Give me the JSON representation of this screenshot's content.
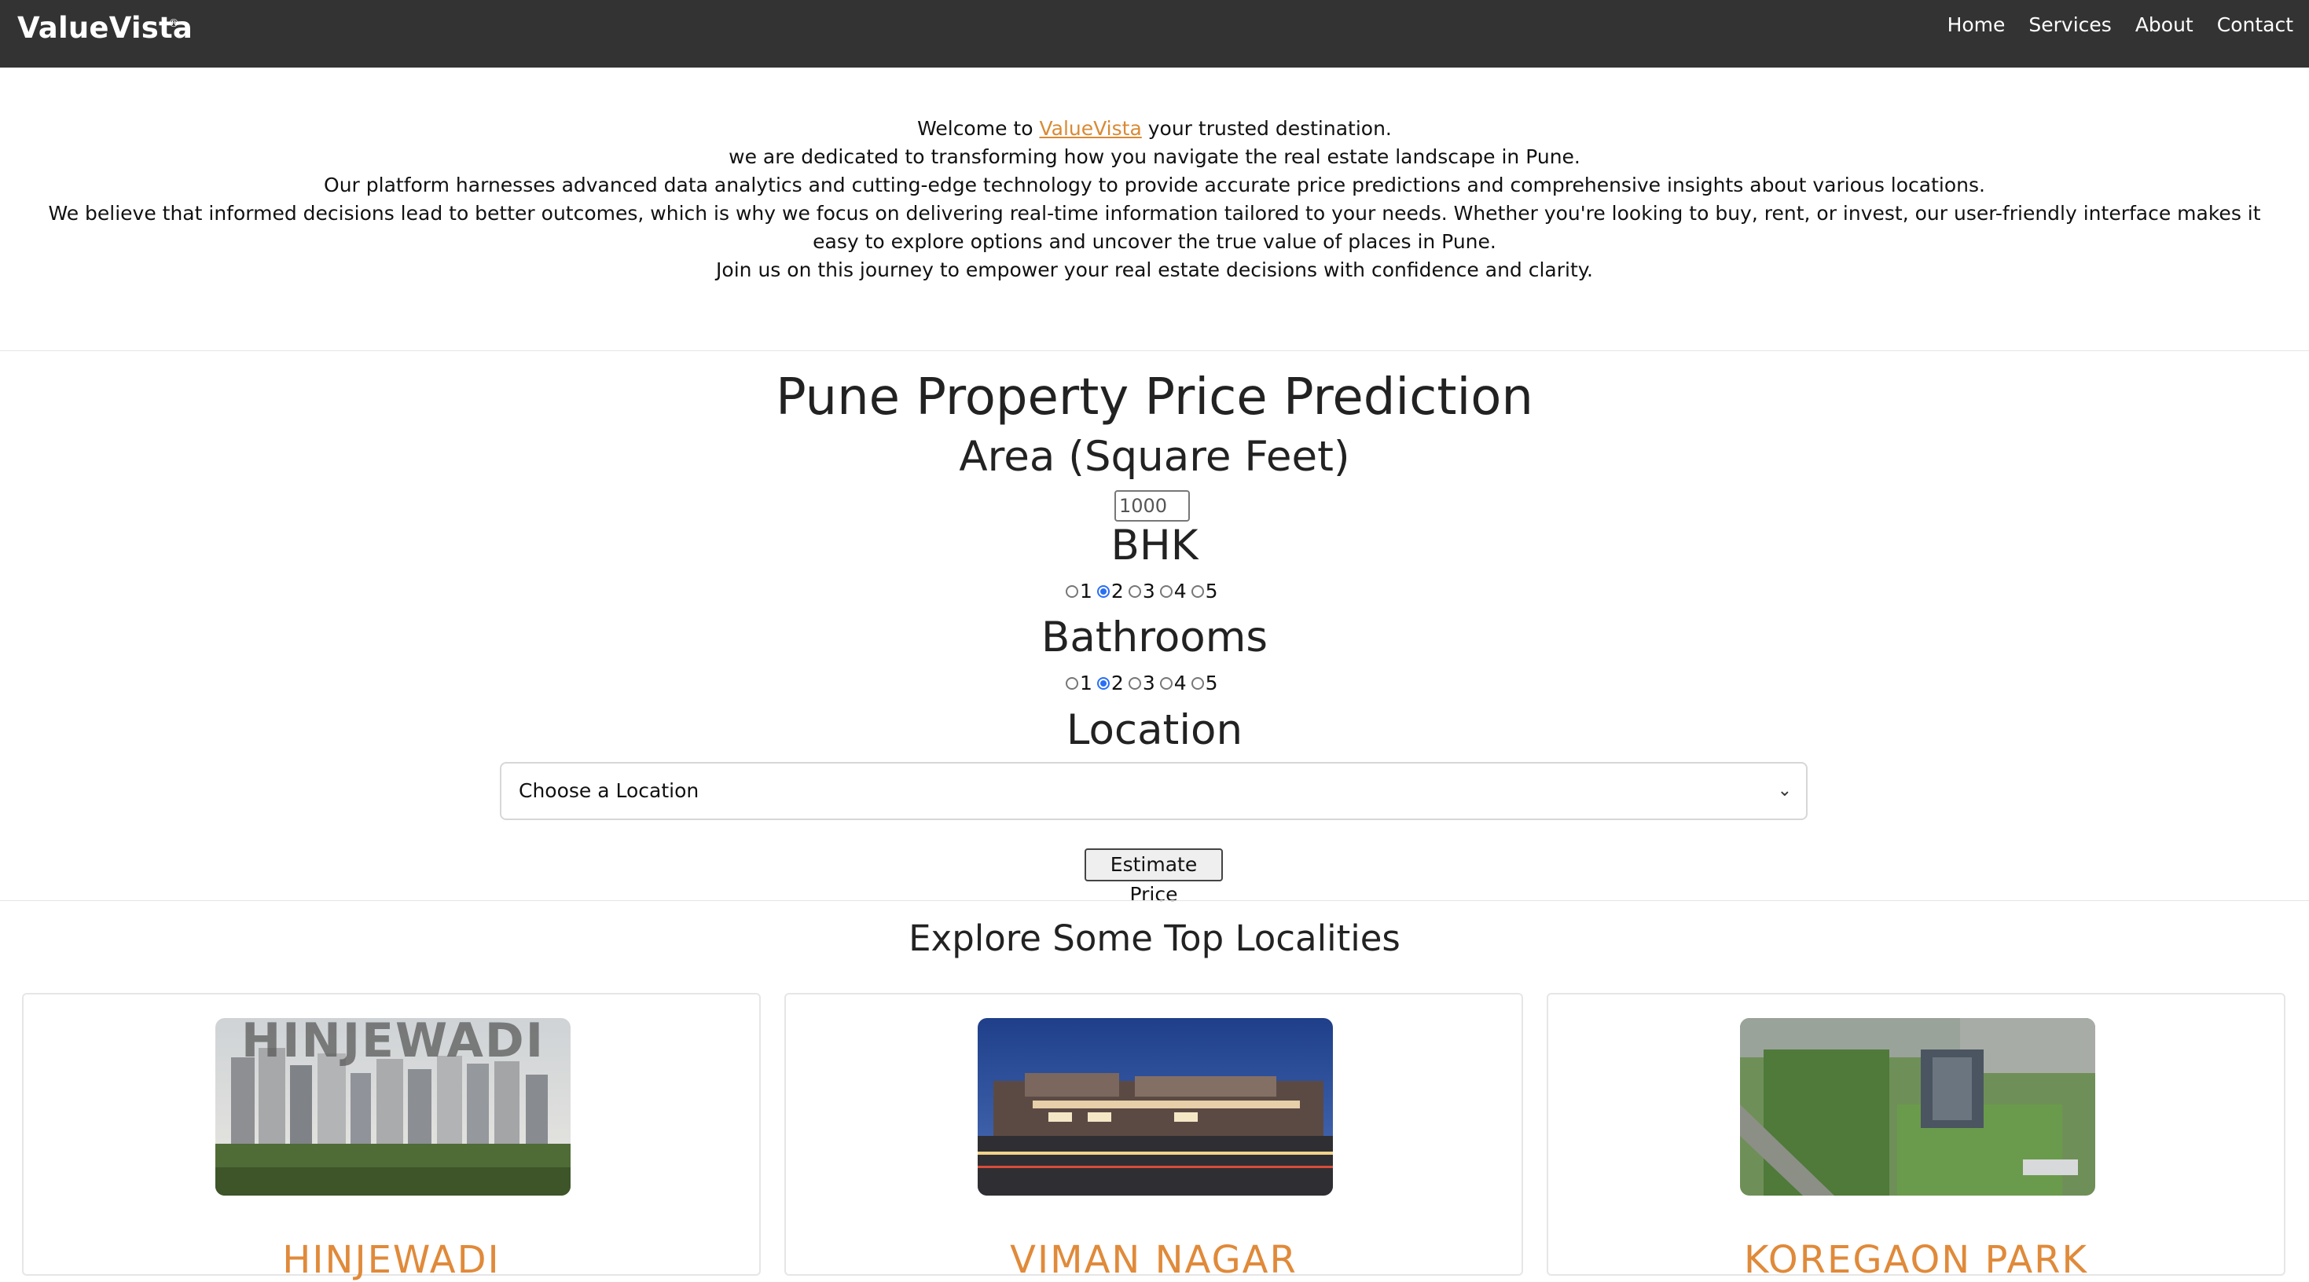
{
  "navbar": {
    "brand": "ValueVista",
    "brand_mark": "®",
    "links": [
      "Home",
      "Services",
      "About",
      "Contact"
    ]
  },
  "intro": {
    "line1_prefix": "Welcome to",
    "line1_link": "ValueVista",
    "line1_suffix": "your trusted destination.",
    "line2": "we are dedicated to transforming how you navigate the real estate landscape in Pune.",
    "line3": "Our platform harnesses advanced data analytics and cutting-edge technology to provide accurate price predictions and comprehensive insights about various locations.",
    "line4": "We believe that informed decisions lead to better outcomes, which is why we focus on delivering real-time information tailored to your needs. Whether you're looking to buy, rent, or invest, our user-friendly interface makes it easy to explore options and uncover the true value of places in Pune.",
    "line5": "Join us on this journey to empower your real estate decisions with confidence and clarity."
  },
  "form": {
    "title": "Pune Property Price Prediction",
    "area_label": "Area (Square Feet)",
    "area_value": "1000",
    "bhk_label": "BHK",
    "bhk_options": [
      "1",
      "2",
      "3",
      "4",
      "5"
    ],
    "bhk_selected": "2",
    "bath_label": "Bathrooms",
    "bath_options": [
      "1",
      "2",
      "3",
      "4",
      "5"
    ],
    "bath_selected": "2",
    "location_label": "Location",
    "location_select": "Choose a Location",
    "estimate_button": "Estimate Price"
  },
  "localities": {
    "title": "Explore Some Top Localities",
    "cards": [
      {
        "name": "HINJEWADI",
        "image_text": "HINJEWADI"
      },
      {
        "name": "VIMAN NAGAR"
      },
      {
        "name": "KOREGAON PARK"
      }
    ]
  },
  "colors": {
    "navbar": "#333333",
    "accent": "#d98a34",
    "radio_checked": "#2a6ff5"
  }
}
